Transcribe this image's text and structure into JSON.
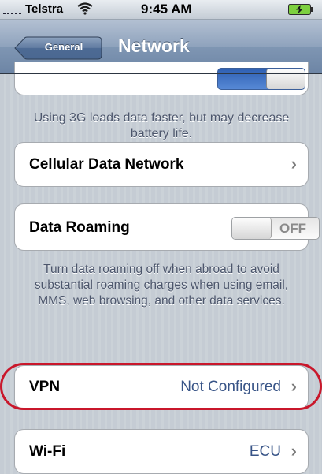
{
  "status_bar": {
    "carrier": "Telstra",
    "time": "9:45 AM"
  },
  "nav": {
    "back_label": "General",
    "title": "Network"
  },
  "three_g": {
    "note": "Using 3G loads data faster, but may decrease battery life."
  },
  "cellular_data_network": {
    "label": "Cellular Data Network"
  },
  "data_roaming": {
    "label": "Data Roaming",
    "toggle_state": "OFF",
    "note": "Turn data roaming off when abroad to avoid substantial roaming charges when using email, MMS, web browsing, and other data services."
  },
  "vpn": {
    "label": "VPN",
    "value": "Not Configured"
  },
  "wifi": {
    "label": "Wi-Fi",
    "value": "ECU"
  },
  "colors": {
    "background": "#c5ccd4",
    "navbar": "#6d85a5",
    "value_text": "#385487",
    "highlight": "#c9172b"
  }
}
